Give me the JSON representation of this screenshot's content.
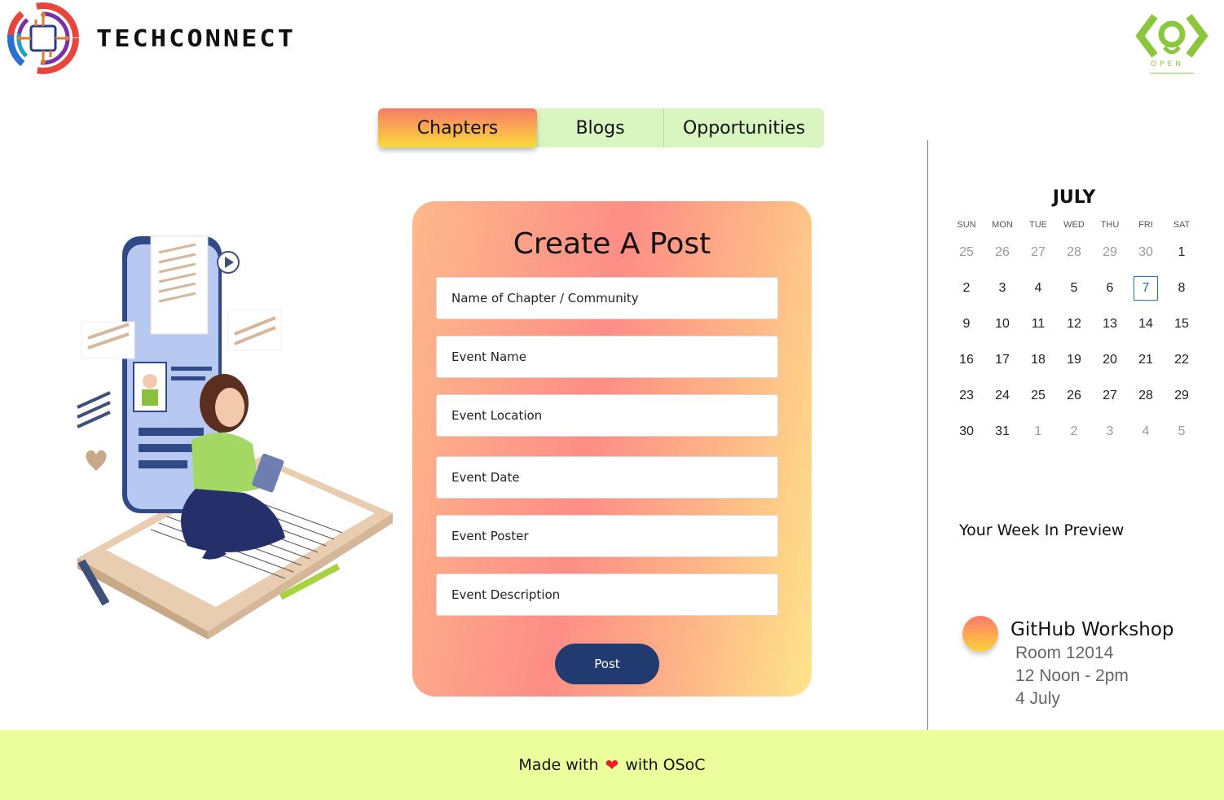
{
  "header": {
    "brand": "TECHCONNECT",
    "open_logo_text": "OPEN"
  },
  "tabs": [
    {
      "label": "Chapters",
      "active": true
    },
    {
      "label": "Blogs",
      "active": false
    },
    {
      "label": "Opportunities",
      "active": false
    }
  ],
  "form": {
    "title": "Create A Post",
    "fields": [
      {
        "placeholder": "Name of Chapter /  Community"
      },
      {
        "placeholder": "Event Name"
      },
      {
        "placeholder": "Event Location"
      },
      {
        "placeholder": "Event Date"
      },
      {
        "placeholder": "Event Poster"
      },
      {
        "placeholder": "Event  Description"
      }
    ],
    "submit_label": "Post"
  },
  "calendar": {
    "month": "JULY",
    "weekdays": [
      "SUN",
      "MON",
      "TUE",
      "WED",
      "THU",
      "FRI",
      "SAT"
    ],
    "weeks": [
      [
        "25",
        "26",
        "27",
        "28",
        "29",
        "30",
        "1"
      ],
      [
        "2",
        "3",
        "4",
        "5",
        "6",
        "7",
        "8"
      ],
      [
        "9",
        "10",
        "11",
        "12",
        "13",
        "14",
        "15"
      ],
      [
        "16",
        "17",
        "18",
        "19",
        "20",
        "21",
        "22"
      ],
      [
        "23",
        "24",
        "25",
        "26",
        "27",
        "28",
        "29"
      ],
      [
        "30",
        "31",
        "1",
        "2",
        "3",
        "4",
        "5"
      ]
    ],
    "today": "7",
    "accent": "#1e73be"
  },
  "preview": {
    "title": "Your Week In Preview",
    "event": {
      "name": "GitHub Workshop",
      "room": "Room 12014",
      "time": "12 Noon - 2pm",
      "date": "4 July"
    }
  },
  "footer": {
    "before": "Made with",
    "heart": "❤",
    "after": "with OSoC"
  },
  "colors": {
    "footer_bg": "#ecfd9c",
    "button_bg": "#213a70",
    "tab_bg": "#daf6c0"
  }
}
